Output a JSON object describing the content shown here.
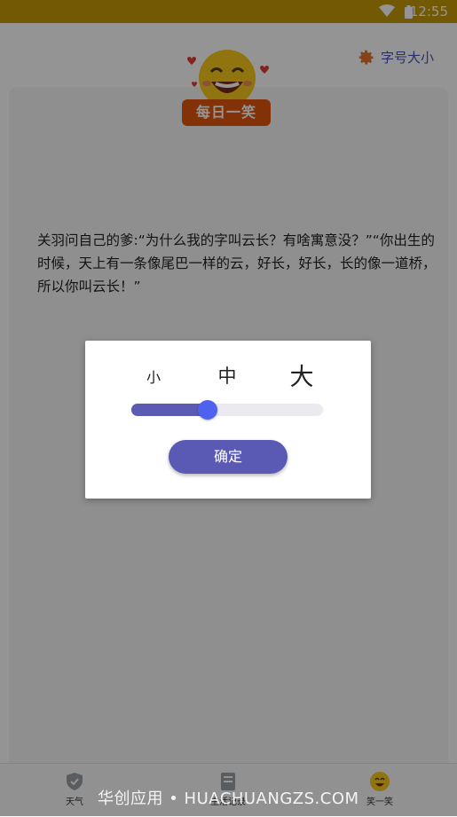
{
  "status_bar": {
    "time": "12:55"
  },
  "header": {
    "font_size_label": "字号大小"
  },
  "card": {
    "badge": "每日一笑",
    "joke": "关羽问自己的爹:“为什么我的字叫云长？有啥寓意没？”“你出生的时候，天上有一条像尾巴一样的云，好长，好长，长的像一道桥，所以你叫云长！”"
  },
  "bottom_nav": [
    {
      "label": "天气",
      "icon": "shield-icon"
    },
    {
      "label": "生活记录",
      "icon": "notebook-icon"
    },
    {
      "label": "笑一笑",
      "icon": "smiley-icon"
    }
  ],
  "dialog": {
    "size_small": "小",
    "size_mid": "中",
    "size_large": "大",
    "slider_value": 0.4,
    "confirm_label": "确定"
  },
  "watermark": "华创应用 • HUACHUANGZS.COM",
  "colors": {
    "accent": "#5a5ab4",
    "status_bar": "#c69a08",
    "badge": "#e2560f"
  }
}
